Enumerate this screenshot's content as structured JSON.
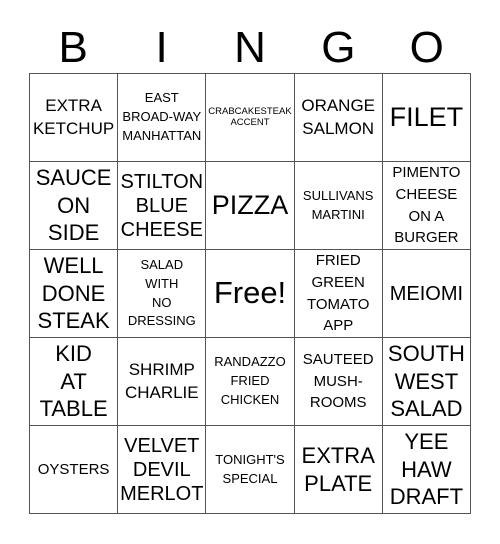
{
  "header": [
    "B",
    "I",
    "N",
    "G",
    "O"
  ],
  "cells": [
    {
      "text": "EXTRA KETCHUP",
      "lines": [
        "EXTRA",
        "KETCHUP"
      ],
      "size": "s4"
    },
    {
      "text": "EAST BROAD-WAY MANHATTAN",
      "lines": [
        "EAST",
        "BROAD-WAY",
        "MANHATTAN"
      ],
      "size": "s2"
    },
    {
      "text": "CRABCAKESTEAK ACCENT",
      "lines": [
        "CRABCAKESTEAK",
        "ACCENT"
      ],
      "size": "s1"
    },
    {
      "text": "ORANGE SALMON",
      "lines": [
        "ORANGE",
        "SALMON"
      ],
      "size": "s4"
    },
    {
      "text": "FILET",
      "lines": [
        "FILET"
      ],
      "size": "s7"
    },
    {
      "text": "SAUCE ON SIDE",
      "lines": [
        "SAUCE",
        "ON",
        "SIDE"
      ],
      "size": "s6"
    },
    {
      "text": "STILTON BLUE CHEESE",
      "lines": [
        "STILTON",
        "BLUE",
        "CHEESE"
      ],
      "size": "s5"
    },
    {
      "text": "PIZZA",
      "lines": [
        "PIZZA"
      ],
      "size": "s7"
    },
    {
      "text": "SULLIVANS MARTINI",
      "lines": [
        "SULLIVANS",
        "MARTINI"
      ],
      "size": "s2"
    },
    {
      "text": "PIMENTO CHEESE ON A BURGER",
      "lines": [
        "PIMENTO",
        "CHEESE",
        "ON A",
        "BURGER"
      ],
      "size": "s3"
    },
    {
      "text": "WELL DONE STEAK",
      "lines": [
        "WELL",
        "DONE",
        "STEAK"
      ],
      "size": "s6"
    },
    {
      "text": "SALAD WITH NO DRESSING",
      "lines": [
        "SALAD",
        "WITH",
        "NO",
        "DRESSING"
      ],
      "size": "s2"
    },
    {
      "text": "Free!",
      "lines": [
        "Free!"
      ],
      "size": "s8"
    },
    {
      "text": "FRIED GREEN TOMATO APP",
      "lines": [
        "FRIED",
        "GREEN",
        "TOMATO",
        "APP"
      ],
      "size": "s3"
    },
    {
      "text": "MEIOMI",
      "lines": [
        "MEIOMI"
      ],
      "size": "s5"
    },
    {
      "text": "KID AT TABLE",
      "lines": [
        "KID",
        "AT",
        "TABLE"
      ],
      "size": "s6"
    },
    {
      "text": "SHRIMP CHARLIE",
      "lines": [
        "SHRIMP",
        "CHARLIE"
      ],
      "size": "s4"
    },
    {
      "text": "RANDAZZO FRIED CHICKEN",
      "lines": [
        "RANDAZZO",
        "FRIED",
        "CHICKEN"
      ],
      "size": "s2"
    },
    {
      "text": "SAUTEED MUSH-ROOMS",
      "lines": [
        "SAUTEED",
        "MUSH-",
        "ROOMS"
      ],
      "size": "s3"
    },
    {
      "text": "SOUTH WEST SALAD",
      "lines": [
        "SOUTH",
        "WEST",
        "SALAD"
      ],
      "size": "s6"
    },
    {
      "text": "OYSTERS",
      "lines": [
        "OYSTERS"
      ],
      "size": "s3"
    },
    {
      "text": "VELVET DEVIL MERLOT",
      "lines": [
        "VELVET",
        "DEVIL",
        "MERLOT"
      ],
      "size": "s5"
    },
    {
      "text": "TONIGHT'S SPECIAL",
      "lines": [
        "TONIGHT'S",
        "SPECIAL"
      ],
      "size": "s2"
    },
    {
      "text": "EXTRA PLATE",
      "lines": [
        "EXTRA",
        "PLATE"
      ],
      "size": "s6"
    },
    {
      "text": "YEE HAW DRAFT",
      "lines": [
        "YEE",
        "HAW",
        "DRAFT"
      ],
      "size": "s6"
    }
  ]
}
